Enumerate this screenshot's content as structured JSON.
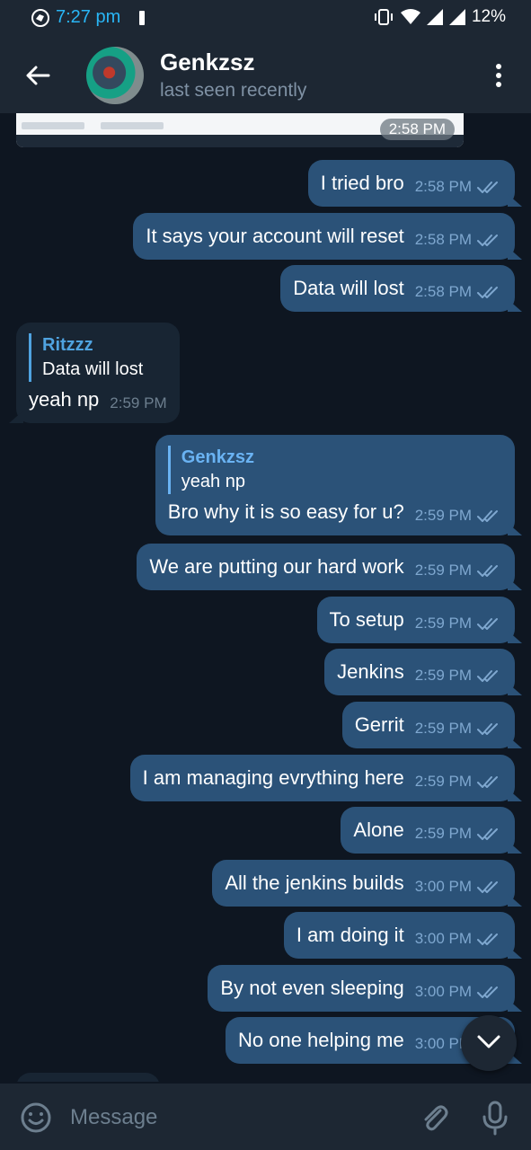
{
  "status_bar": {
    "time": "7:27 pm",
    "battery": "12%"
  },
  "header": {
    "name": "Genkzsz",
    "status": "last seen recently"
  },
  "image_message": {
    "time": "2:58 PM"
  },
  "messages": [
    {
      "dir": "out",
      "text": "I tried bro",
      "time": "2:58 PM"
    },
    {
      "dir": "out",
      "text": "It says your account will reset",
      "time": "2:58 PM"
    },
    {
      "dir": "out",
      "text": "Data will lost",
      "time": "2:58 PM"
    },
    {
      "dir": "in",
      "reply_name": "Ritzzz",
      "reply_text": "Data will lost",
      "text": "yeah np",
      "time": "2:59 PM"
    },
    {
      "dir": "out",
      "reply_name": "Genkzsz",
      "reply_text": "yeah np",
      "text": "Bro why it is so easy for u?",
      "time": "2:59 PM"
    },
    {
      "dir": "out",
      "text": "We are putting our hard work",
      "time": "2:59 PM"
    },
    {
      "dir": "out",
      "text": "To setup",
      "time": "2:59 PM"
    },
    {
      "dir": "out",
      "text": "Jenkins",
      "time": "2:59 PM"
    },
    {
      "dir": "out",
      "text": "Gerrit",
      "time": "2:59 PM"
    },
    {
      "dir": "out",
      "text": "I am managing evrything here",
      "time": "2:59 PM"
    },
    {
      "dir": "out",
      "text": "Alone",
      "time": "2:59 PM"
    },
    {
      "dir": "out",
      "text": "All the jenkins builds",
      "time": "3:00 PM"
    },
    {
      "dir": "out",
      "text": "I am doing it",
      "time": "3:00 PM"
    },
    {
      "dir": "out",
      "text": "By not even sleeping",
      "time": "3:00 PM"
    },
    {
      "dir": "out",
      "text": "No one helping me",
      "time": "3:00 PM"
    }
  ],
  "composer": {
    "placeholder": "Message"
  },
  "colors": {
    "bg": "#0e1621",
    "bar": "#1d2733",
    "outgoing": "#2b5278",
    "incoming": "#182533",
    "accent": "#6ab3f3"
  }
}
